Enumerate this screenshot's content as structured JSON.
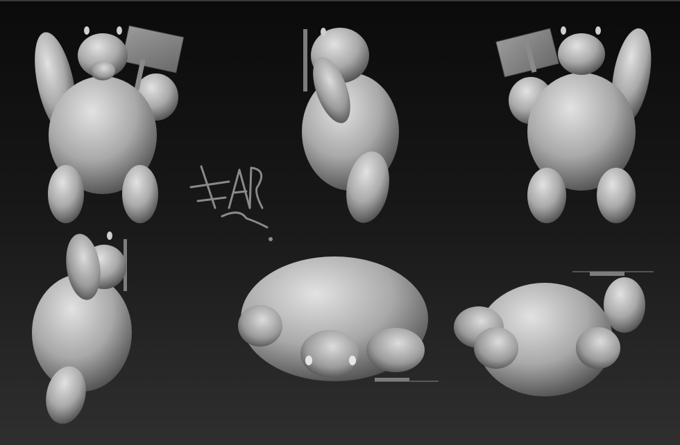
{
  "image": {
    "subject": "sculpted-character-turnaround",
    "view_count": 6,
    "colors": {
      "background_top": "#0b0b0b",
      "background_bottom": "#2f2f2f",
      "material_light": "#d6d6d6",
      "material_dark": "#4a4a4a",
      "signature": "#8a8a8a"
    }
  }
}
